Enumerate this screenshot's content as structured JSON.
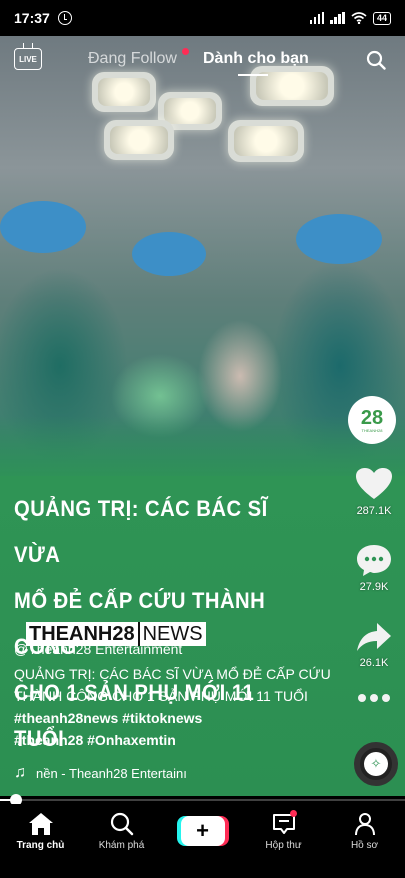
{
  "status_bar": {
    "time": "17:37",
    "battery": "44"
  },
  "top_nav": {
    "live_label": "LIVE",
    "tab_following": "Đang Follow",
    "tab_for_you": "Dành cho bạn"
  },
  "video": {
    "headline_lines": [
      "QUẢNG TRỊ: CÁC BÁC SĨ VỪA",
      "MỔ ĐẺ CẤP CỨU THÀNH CÔNG",
      "CHO 1 SẢN PHỤ MỚI 11 TUỔI"
    ],
    "brand_part1": "THEANH28",
    "brand_part2": "NEWS",
    "corner_logo": "28",
    "corner_logo_sub": "THEANH28"
  },
  "rail": {
    "likes": "287.1K",
    "comments": "27.9K",
    "shares": "26.1K"
  },
  "caption": {
    "author": "@Theanh28 Entertainment",
    "text": "QUẢNG TRỊ: CÁC BÁC SĨ VỪA MỔ ĐẺ CẤP CỨU THÀNH CÔNG CHO 1 SẢN PHỤ MỚI 11 TUỔI",
    "hashtags_line1": "#theanh28news #tiktoknews",
    "hashtags_line2": "#theanh28 #Onhaxemtin",
    "music": "nền - Theanh28 Entertainı"
  },
  "progress": {
    "fraction": 0.04
  },
  "bottom_nav": {
    "home": "Trang chủ",
    "discover": "Khám phá",
    "inbox": "Hộp thư",
    "profile": "Hồ sơ"
  },
  "colors": {
    "accent_red": "#fe2c55",
    "accent_cyan": "#25f4ee",
    "brand_green": "#2f9455"
  }
}
